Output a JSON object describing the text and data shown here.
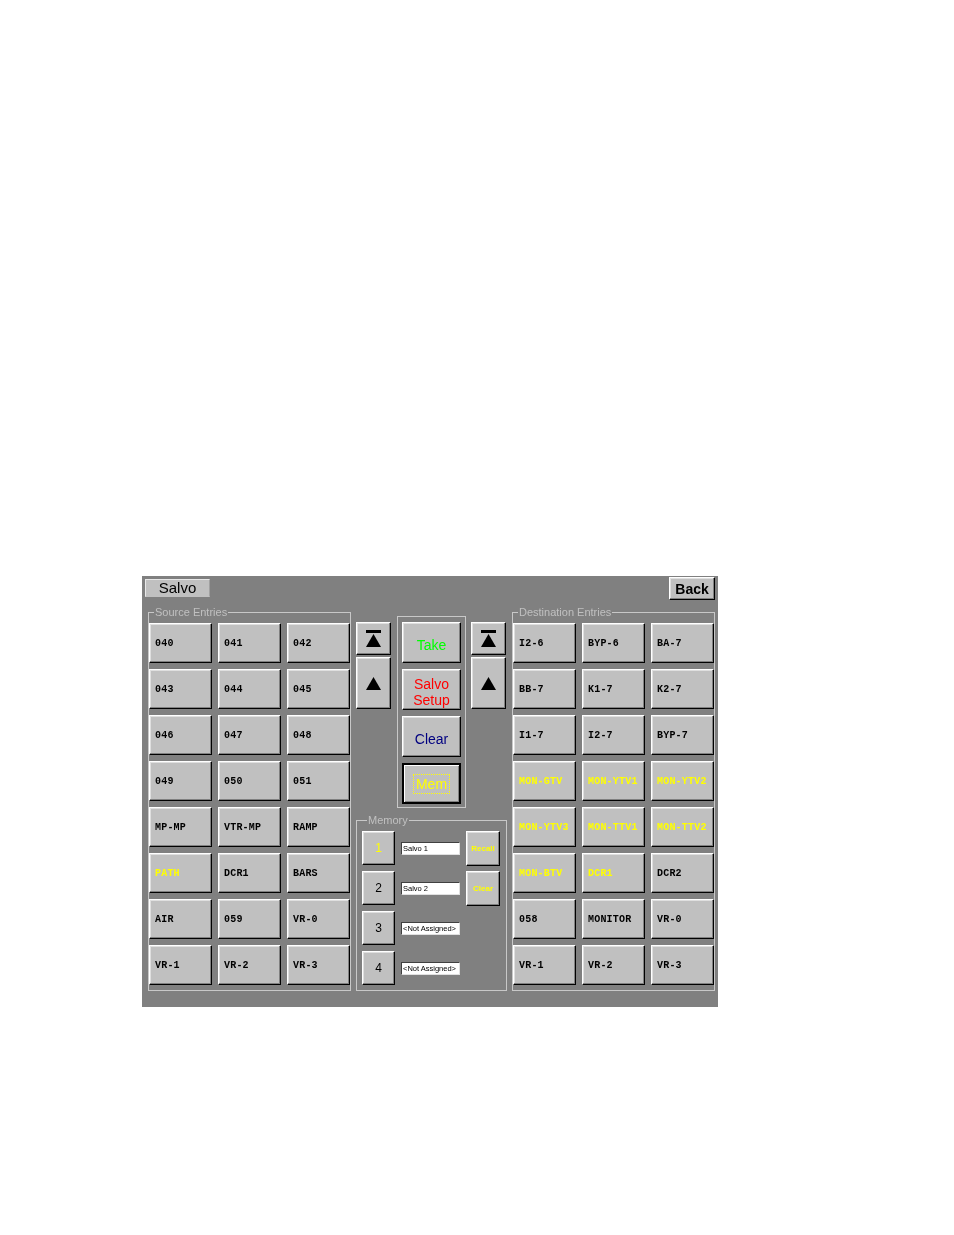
{
  "header": {
    "title": "Salvo",
    "back_button": "Back"
  },
  "source_entries": {
    "legend": "Source Entries",
    "items": [
      {
        "label": "040",
        "selected": false
      },
      {
        "label": "041",
        "selected": false
      },
      {
        "label": "042",
        "selected": false
      },
      {
        "label": "043",
        "selected": false
      },
      {
        "label": "044",
        "selected": false
      },
      {
        "label": "045",
        "selected": false
      },
      {
        "label": "046",
        "selected": false
      },
      {
        "label": "047",
        "selected": false
      },
      {
        "label": "048",
        "selected": false
      },
      {
        "label": "049",
        "selected": false
      },
      {
        "label": "050",
        "selected": false
      },
      {
        "label": "051",
        "selected": false
      },
      {
        "label": "MP-MP",
        "selected": false
      },
      {
        "label": "VTR-MP",
        "selected": false
      },
      {
        "label": "RAMP",
        "selected": false
      },
      {
        "label": "PATH",
        "selected": true
      },
      {
        "label": "DCR1",
        "selected": false
      },
      {
        "label": "BARS",
        "selected": false
      },
      {
        "label": "AIR",
        "selected": false
      },
      {
        "label": "059",
        "selected": false
      },
      {
        "label": "VR-0",
        "selected": false
      },
      {
        "label": "VR-1",
        "selected": false
      },
      {
        "label": "VR-2",
        "selected": false
      },
      {
        "label": "VR-3",
        "selected": false
      }
    ]
  },
  "source_scroll": [
    {
      "kind": "top"
    },
    {
      "kind": "up"
    }
  ],
  "controls": [
    {
      "label": "Take",
      "color": "#00ff00",
      "focused": false
    },
    {
      "label": "Salvo Setup",
      "color": "#ff0000",
      "focused": false
    },
    {
      "label": "Clear",
      "color": "#000080",
      "focused": false
    },
    {
      "label": "Mem",
      "color": "#ffff00",
      "focused": true
    }
  ],
  "destination_scroll": [
    {
      "kind": "top"
    },
    {
      "kind": "up"
    }
  ],
  "memory": {
    "legend": "Memory",
    "slots": [
      {
        "number": "1",
        "name": "Salvo 1",
        "selected": true
      },
      {
        "number": "2",
        "name": "Salvo 2",
        "selected": false
      },
      {
        "number": "3",
        "name": "<Not Assigned>",
        "selected": false
      },
      {
        "number": "4",
        "name": "<Not Assigned>",
        "selected": false
      }
    ],
    "actions": [
      {
        "label": "Recall",
        "active": true
      },
      {
        "label": "Clear",
        "active": true
      }
    ]
  },
  "destination_entries": {
    "legend": "Destination Entries",
    "items": [
      {
        "label": "I2-6",
        "selected": false
      },
      {
        "label": "BYP-6",
        "selected": false
      },
      {
        "label": "BA-7",
        "selected": false
      },
      {
        "label": "BB-7",
        "selected": false
      },
      {
        "label": "K1-7",
        "selected": false
      },
      {
        "label": "K2-7",
        "selected": false
      },
      {
        "label": "I1-7",
        "selected": false
      },
      {
        "label": "I2-7",
        "selected": false
      },
      {
        "label": "BYP-7",
        "selected": false
      },
      {
        "label": "MON-GTV",
        "selected": true
      },
      {
        "label": "MON-YTV1",
        "selected": true
      },
      {
        "label": "MON-YTV2",
        "selected": true
      },
      {
        "label": "MON-YTV3",
        "selected": true
      },
      {
        "label": "MON-TTV1",
        "selected": true
      },
      {
        "label": "MON-TTV2",
        "selected": true
      },
      {
        "label": "MON-BTV",
        "selected": true
      },
      {
        "label": "DCR1",
        "selected": true
      },
      {
        "label": "DCR2",
        "selected": false
      },
      {
        "label": "058",
        "selected": false
      },
      {
        "label": "MONITOR",
        "selected": false
      },
      {
        "label": "VR-0",
        "selected": false
      },
      {
        "label": "VR-1",
        "selected": false
      },
      {
        "label": "VR-2",
        "selected": false
      },
      {
        "label": "VR-3",
        "selected": false
      }
    ]
  }
}
